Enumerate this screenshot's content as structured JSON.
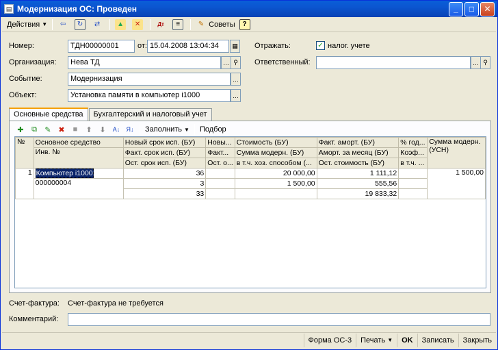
{
  "window": {
    "title": "Модернизация ОС: Проведен"
  },
  "toolbar": {
    "actions_label": "Действия",
    "advice_label": "Советы",
    "help_label": "?"
  },
  "form": {
    "number_label": "Номер:",
    "number_value": "ТДН00000001",
    "date_label": "от:",
    "date_value": "15.04.2008 13:04:34",
    "org_label": "Организация:",
    "org_value": "Нева ТД",
    "event_label": "Событие:",
    "event_value": "Модернизация",
    "object_label": "Объект:",
    "object_value": "Установка памяти в компьютер i1000",
    "reflect_label": "Отражать:",
    "tax_label": "налог. учете",
    "responsible_label": "Ответственный:",
    "responsible_value": ""
  },
  "tabs": [
    {
      "label": "Основные средства"
    },
    {
      "label": "Бухгалтерский и налоговый учет"
    }
  ],
  "grid_toolbar": {
    "fill_label": "Заполнить",
    "select_label": "Подбор"
  },
  "grid": {
    "headers": {
      "r1": [
        "№",
        "Основное средство",
        "Новый срок исп. (БУ)",
        "Новы...",
        "Стоимость (БУ)",
        "Факт. аморт. (БУ)",
        "% год...",
        "Сумма модерн."
      ],
      "r2": [
        "Инв. №",
        "Факт. срок исп. (БУ)",
        "Факт...",
        "Сумма модерн. (БУ)",
        "Аморт. за месяц (БУ)",
        "Коэф...",
        "(УСН)"
      ],
      "r3": [
        "Ост. срок исп. (БУ)",
        "Ост. о...",
        "в т.ч. хоз. способом (...",
        "Ост. стоимость (БУ)",
        "в т.ч. ..."
      ]
    },
    "row": {
      "n": "1",
      "asset": "Компьютер i1000",
      "inv": "000000004",
      "new_term": "36",
      "fact_term": "3",
      "rest_term": "33",
      "cost": "20 000,00",
      "modern_sum": "1 500,00",
      "amort": "1 111,12",
      "amort_month": "555,56",
      "rest_cost": "19 833,32",
      "usn_sum": "1 500,00"
    }
  },
  "invoice": {
    "label": "Счет-фактура:",
    "value": "Счет-фактура не требуется"
  },
  "comment": {
    "label": "Комментарий:",
    "value": ""
  },
  "status": {
    "form": "Форма ОС-3",
    "print": "Печать",
    "ok": "OK",
    "save": "Записать",
    "close": "Закрыть"
  }
}
